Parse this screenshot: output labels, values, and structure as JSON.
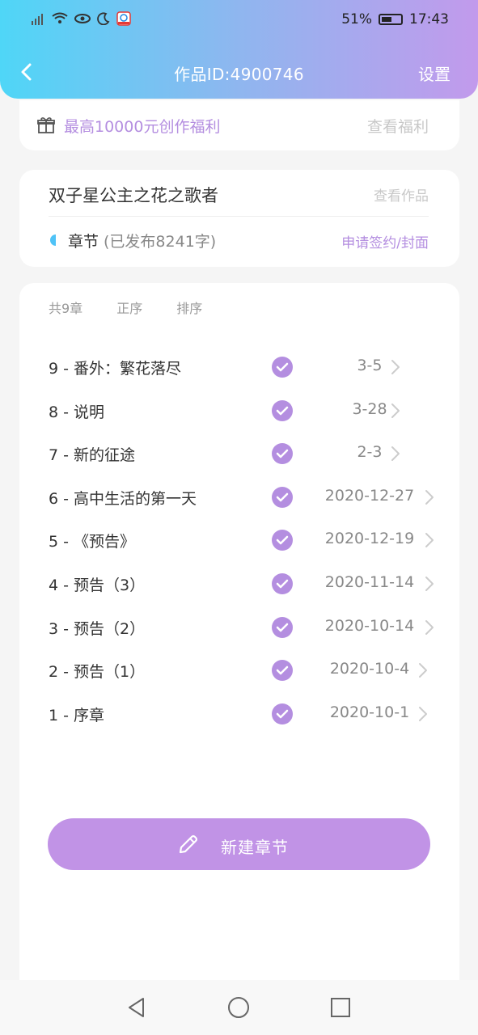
{
  "status_bar": {
    "battery": "51%",
    "time": "17:43"
  },
  "header": {
    "title": "作品ID:4900746",
    "settings_label": "设置"
  },
  "welfare": {
    "text": "最高10000元创作福利",
    "link": "查看福利"
  },
  "work": {
    "name": "双子星公主之花之歌者",
    "view_link": "查看作品",
    "chapters_label": "章节",
    "chapters_count": "(已发布8241字)",
    "apply_link": "申请签约/封面"
  },
  "chapter_list": {
    "toolbar": {
      "total": "共9章",
      "order": "正序",
      "sort": "排序"
    },
    "chapters": [
      {
        "title": "9 - 番外：繁花落尽",
        "date": "3-5"
      },
      {
        "title": "8 - 说明",
        "date": "3-28"
      },
      {
        "title": "7 - 新的征途",
        "date": "2-3"
      },
      {
        "title": "6 - 高中生活的第一天",
        "date": "2020-12-27"
      },
      {
        "title": "5 - 《预告》",
        "date": "2020-12-19"
      },
      {
        "title": "4 - 预告（3）",
        "date": "2020-11-14"
      },
      {
        "title": "3 - 预告（2）",
        "date": "2020-10-14"
      },
      {
        "title": "2 - 预告（1）",
        "date": "2020-10-4"
      },
      {
        "title": "1 - 序章",
        "date": "2020-10-1"
      }
    ],
    "new_chapter_label": "新建章节"
  },
  "colors": {
    "accent": "#b48ee0",
    "button": "#c193e6",
    "gradient_start": "#4fd6f7",
    "gradient_end": "#c29aec",
    "chapter_marker": "#4fc3f7"
  },
  "icons": {
    "back": "chevron-left-icon",
    "gift": "gift-icon",
    "check": "check-circle-icon",
    "row_chevron": "chevron-right-icon",
    "pen": "pencil-icon",
    "sys_back": "triangle-back-icon",
    "sys_home": "circle-home-icon",
    "sys_recent": "square-recent-icon"
  }
}
